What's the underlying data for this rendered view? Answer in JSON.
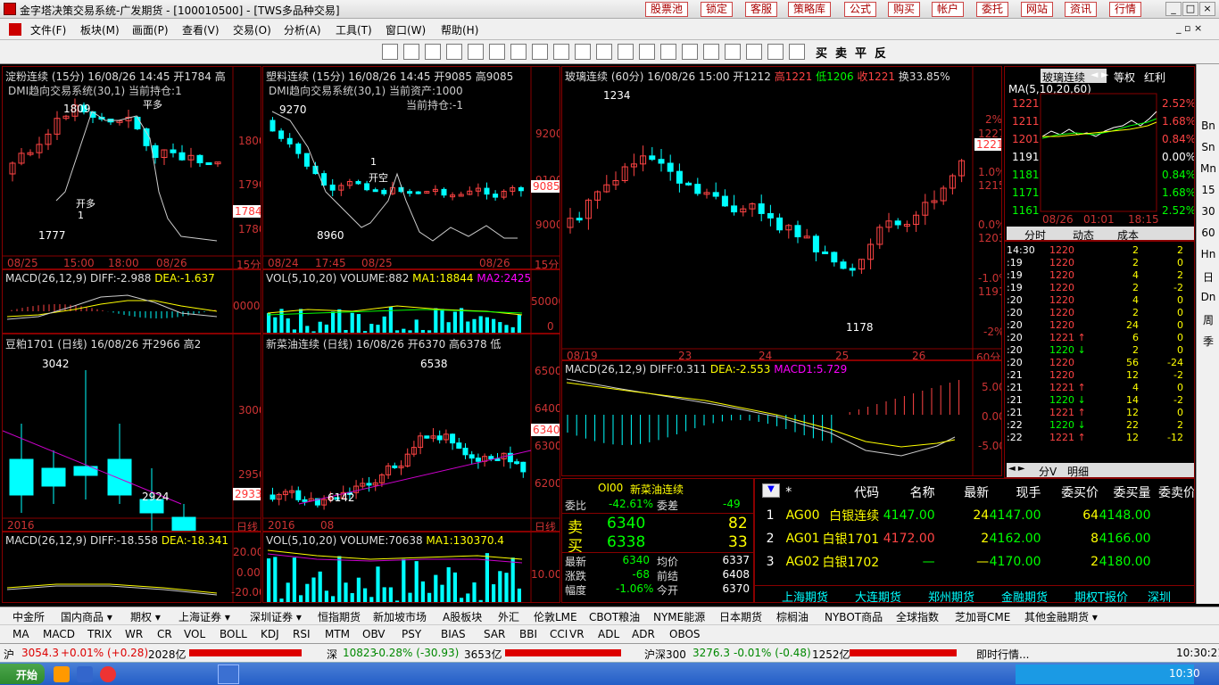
{
  "window": {
    "title": "金字塔决策交易系统-广发期货 - [100010500] - [TWS多品种交易]",
    "top_buttons": [
      "股票池",
      "锁定",
      "客服",
      "策略库",
      "公式",
      "购买",
      "帐户",
      "委托",
      "网站",
      "资讯",
      "行情"
    ]
  },
  "menu": [
    "文件(F)",
    "板块(M)",
    "画面(P)",
    "查看(V)",
    "交易(O)",
    "分析(A)",
    "工具(T)",
    "窗口(W)",
    "帮助(H)"
  ],
  "toolbar": {
    "buy": "买",
    "sell": "卖",
    "flat": "平",
    "rev": "反"
  },
  "panels": {
    "p1": {
      "title": "淀粉连续 (15分) 16/08/26 14:45 开1784 高",
      "sub": "DMI趋向交易系统(30,1) 当前持仓:1",
      "prices": [
        "1800",
        "1790",
        "1780"
      ],
      "hi": "1809",
      "lo": "1777",
      "last": "1784",
      "dates": [
        "08/25",
        "15:00",
        "18:00",
        "08/26"
      ],
      "period": "15分",
      "sig1": "开多",
      "sig1n": "1",
      "sig2": "平多"
    },
    "p2": {
      "title": "塑料连续 (15分) 16/08/26 14:45 开9085 高9085",
      "sub": "DMI趋向交易系统(30,1) 当前资产:1000",
      "sub2": "当前持仓:-1",
      "prices": [
        "9200",
        "9100",
        "9000"
      ],
      "hi": "9270",
      "lo": "8960",
      "last": "9085",
      "dates": [
        "08/24",
        "17:45",
        "08/25",
        "08/26"
      ],
      "period": "15分",
      "sig1": "开空",
      "sig1n": "1"
    },
    "p1m": {
      "label": "MACD(26,12,9)",
      "diff": "DIFF:-2.988",
      "dea": "DEA:-1.637",
      "axis": "0000"
    },
    "p2v": {
      "label": "VOL(5,10,20)",
      "vol": "VOLUME:882",
      "ma1": "MA1:18844",
      "ma2": "MA2:2425",
      "axis": [
        "50000",
        "0"
      ]
    },
    "p3": {
      "title": "豆粕1701 (日线) 16/08/26 开2966 高2",
      "prices": [
        "3000",
        "2950"
      ],
      "hi": "3042",
      "lo": "2924",
      "last": "2933",
      "dates": [
        "2016"
      ],
      "period": "日线"
    },
    "p4": {
      "title": "新菜油连续 (日线) 16/08/26 开6370 高6378 低",
      "prices": [
        "6500",
        "6400",
        "6300",
        "6200"
      ],
      "hi": "6538",
      "lo": "6142",
      "last": "6340",
      "dates": [
        "2016",
        "08"
      ],
      "period": "日线"
    },
    "p3m": {
      "label": "MACD(26,12,9)",
      "diff": "DIFF:-18.558",
      "dea": "DEA:-18.341",
      "axis": [
        "20.00",
        "0.00",
        "-20.00"
      ]
    },
    "p4v": {
      "label": "VOL(5,10,20)",
      "vol": "VOLUME:70638",
      "ma1": "MA1:130370.4",
      "axis": "10.00"
    },
    "p5": {
      "title": "玻璃连续 (60分) 16/08/26 15:00 开1212",
      "hi_t": "高1221",
      "lo_t": "低1206",
      "close_t": "收1221",
      "chg": "换33.85%",
      "prices": [
        "1227",
        "1215",
        "1203",
        "1191"
      ],
      "pct": [
        "2%",
        "1.0%",
        "0.0%",
        "-1.0%",
        "-2%"
      ],
      "hi": "1234",
      "lo": "1178",
      "last": "1221",
      "dates": [
        "08/19",
        "23",
        "24",
        "25",
        "26"
      ],
      "period": "60分"
    },
    "p5m": {
      "label": "MACD(26,12,9)",
      "diff": "DIFF:0.311",
      "dea": "DEA:-2.553",
      "macd": "MACD1:5.729",
      "axis": [
        "5.00",
        "0.00",
        "-5.00"
      ]
    }
  },
  "mini": {
    "name": "玻璃连续",
    "tabs": [
      "等权",
      "红利"
    ],
    "ma": "MA(5,10,20,60)",
    "prices": [
      "1221",
      "1211",
      "1201",
      "1191",
      "1181",
      "1171",
      "1161"
    ],
    "pct": [
      "2.52%",
      "1.68%",
      "0.84%",
      "0.00%",
      "0.84%",
      "1.68%",
      "2.52%"
    ],
    "times": [
      "08/26",
      "01:01",
      "18:15"
    ],
    "subtabs": [
      "分时",
      "动态",
      "成本"
    ]
  },
  "ticks": {
    "rows": [
      [
        "14:30",
        "1220",
        "2",
        "2"
      ],
      [
        ":19",
        "1220",
        "2",
        "0"
      ],
      [
        ":19",
        "1220",
        "4",
        "2"
      ],
      [
        ":19",
        "1220",
        "2",
        "-2"
      ],
      [
        ":20",
        "1220",
        "4",
        "0"
      ],
      [
        ":20",
        "1220",
        "2",
        "0"
      ],
      [
        ":20",
        "1220",
        "24",
        "0"
      ],
      [
        ":20",
        "1221 ↑",
        "6",
        "0"
      ],
      [
        ":20",
        "1220 ↓",
        "2",
        "0"
      ],
      [
        ":20",
        "1220",
        "56",
        "-24"
      ],
      [
        ":21",
        "1220",
        "12",
        "-2"
      ],
      [
        ":21",
        "1221 ↑",
        "4",
        "0"
      ],
      [
        ":21",
        "1220 ↓",
        "14",
        "-2"
      ],
      [
        ":21",
        "1221 ↑",
        "12",
        "0"
      ],
      [
        ":22",
        "1220 ↓",
        "22",
        "2"
      ],
      [
        ":22",
        "1221 ↑",
        "12",
        "-12"
      ]
    ],
    "tabs": [
      "分V",
      "明细"
    ]
  },
  "quote": {
    "code": "OI00",
    "name": "新菜油连续",
    "wb_label": "委比",
    "wb": "-42.61%",
    "wc_label": "委差",
    "wc": "-49",
    "sell_label": "卖",
    "sell": "6340",
    "sell_vol": "82",
    "buy_label": "买",
    "buy": "6338",
    "buy_vol": "33",
    "rows": [
      [
        "最新",
        "6340",
        "均价",
        "6337"
      ],
      [
        "涨跌",
        "-68",
        "前结",
        "6408"
      ],
      [
        "幅度",
        "-1.06%",
        "今开",
        "6370"
      ]
    ]
  },
  "table": {
    "headers": [
      "*",
      "代码",
      "名称",
      "最新",
      "现手",
      "委买价",
      "委买量",
      "委卖价"
    ],
    "rows": [
      [
        "1",
        "AG00",
        "白银连续",
        "4147.00",
        "24",
        "4147.00",
        "64",
        "4148.00"
      ],
      [
        "2",
        "AG01",
        "白银1701",
        "4172.00",
        "2",
        "4162.00",
        "8",
        "4166.00"
      ],
      [
        "3",
        "AG02",
        "白银1702",
        "—",
        "—",
        "4170.00",
        "2",
        "4180.00"
      ]
    ],
    "market_tabs": [
      "上海期货",
      "大连期货",
      "郑州期货",
      "金融期货",
      "期权T报价",
      "深圳"
    ]
  },
  "rside": [
    "Bn",
    "Sn",
    "Mn",
    "15",
    "30",
    "60",
    "Hn",
    "日",
    "Dn",
    "周",
    "季"
  ],
  "bottom_tabs": [
    "中金所",
    "国内商品 ▾",
    "期权 ▾",
    "上海证券 ▾",
    "深圳证券 ▾",
    "恒指期货",
    "新加坡市场",
    "A股板块",
    "外汇",
    "伦敦LME",
    "CBOT粮油",
    "NYME能源",
    "日本期货",
    "棕榈油",
    "NYBOT商品",
    "全球指数",
    "芝加哥CME",
    "其他金融期货 ▾"
  ],
  "indicators": [
    "MA",
    "MACD",
    "TRIX",
    "WR",
    "CR",
    "VOL",
    "BOLL",
    "KDJ",
    "RSI",
    "MTM",
    "OBV",
    "PSY",
    "BIAS",
    "SAR",
    "BBI",
    "CCI",
    "VR",
    "ADL",
    "ADR",
    "OBOS"
  ],
  "status": {
    "sh_label": "沪",
    "sh": "3054.3",
    "sh_chg": "+0.01% (+0.28)",
    "sh_amt": "2028亿",
    "sz_label": "深",
    "sz": "10823",
    "sz_chg": "-0.28% (-30.93)",
    "sz_amt": "3653亿",
    "hs_label": "沪深300",
    "hs": "3276.3",
    "hs_chg": "-0.01% (-0.48)",
    "hs_amt": "1252亿",
    "live": "即时行情...",
    "time": "10:30:21"
  },
  "taskbar": {
    "start": "开始",
    "clock": "10:30"
  }
}
